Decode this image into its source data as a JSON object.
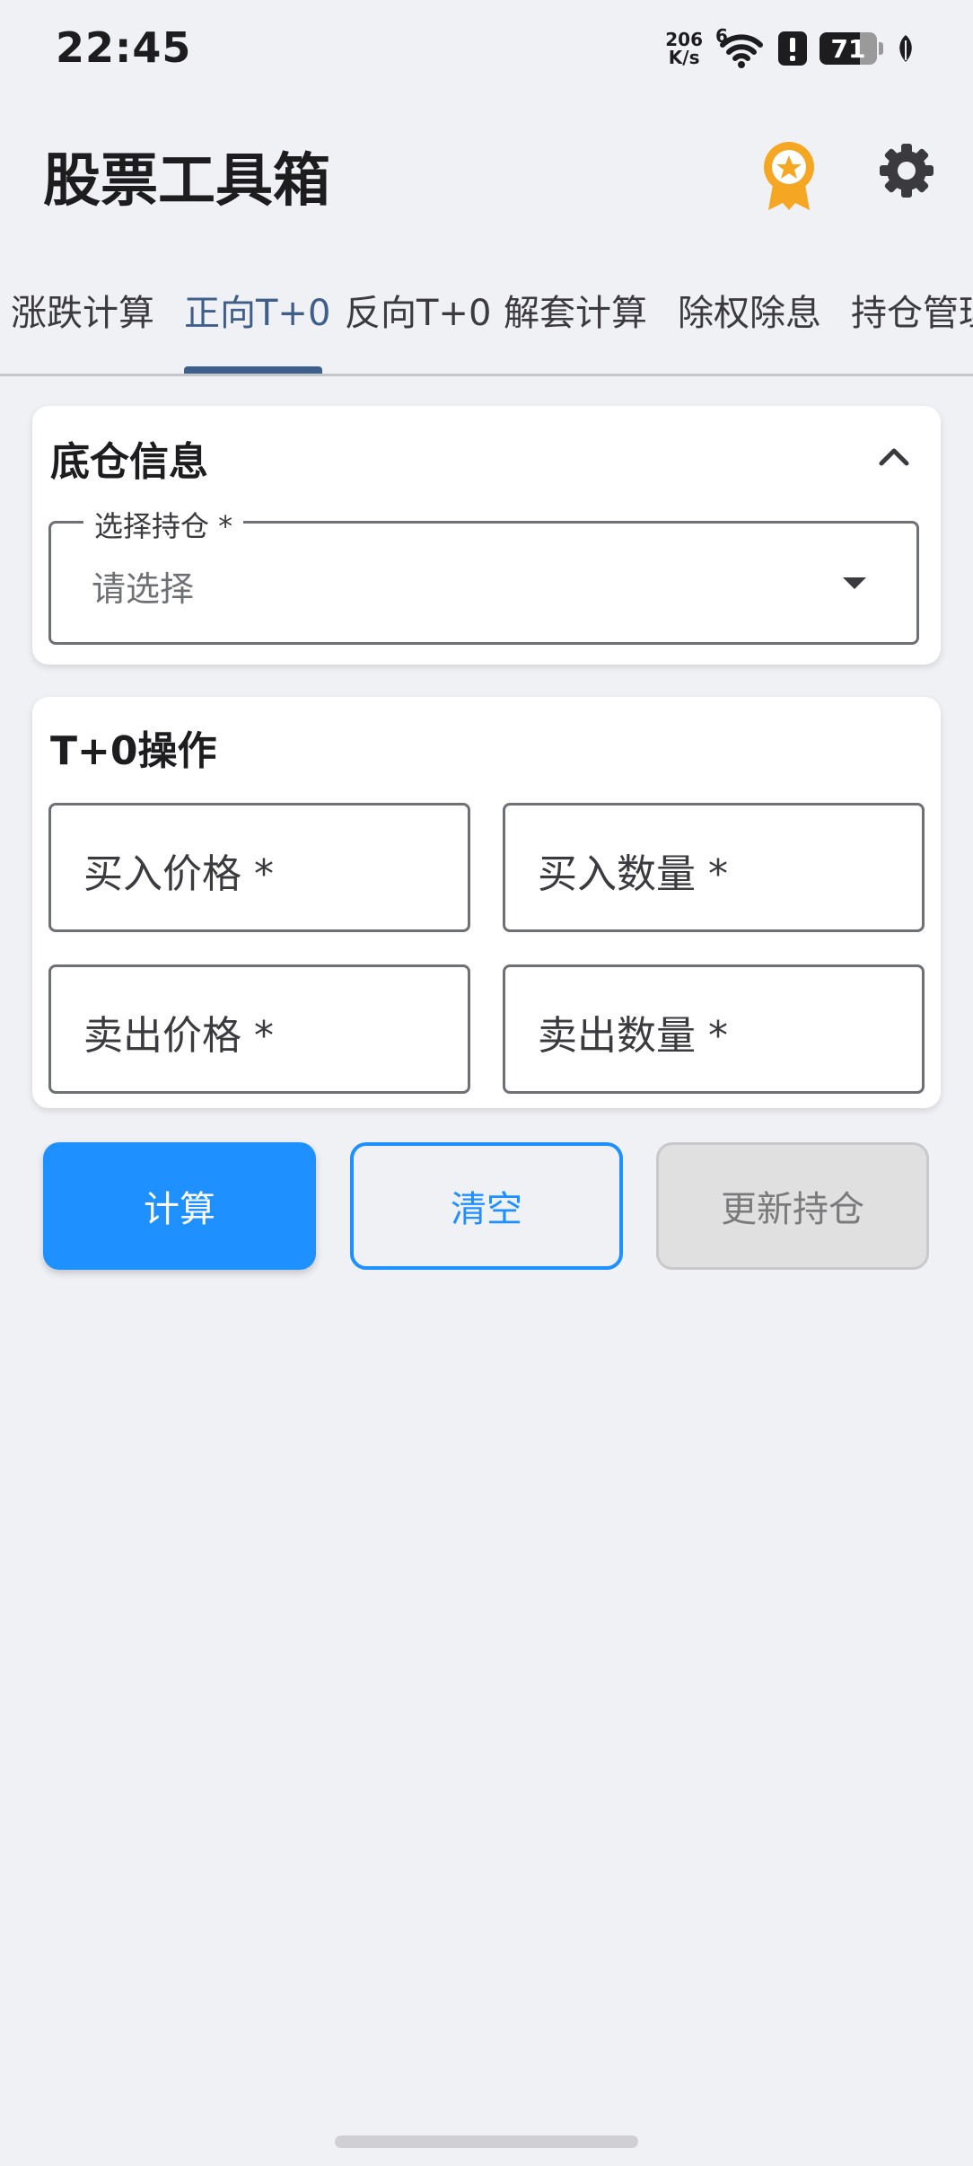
{
  "status_bar": {
    "time": "22:45",
    "net_speed_value": "206",
    "net_speed_unit": "K/s",
    "signal_label": "6",
    "battery_level": "71",
    "battery_percent": 71
  },
  "app_bar": {
    "title": "股票工具箱"
  },
  "tabs": [
    {
      "label": "涨跌计算",
      "active": false
    },
    {
      "label": "正向T+0",
      "active": true
    },
    {
      "label": "反向T+0",
      "active": false
    },
    {
      "label": "解套计算",
      "active": false
    },
    {
      "label": "除权除息",
      "active": false
    },
    {
      "label": "持仓管理",
      "active": false
    }
  ],
  "position_card": {
    "title": "底仓信息",
    "select_label": "选择持仓 *",
    "select_placeholder": "请选择"
  },
  "t0_card": {
    "title": "T+0操作",
    "buy_price_label": "买入价格 *",
    "buy_qty_label": "买入数量 *",
    "sell_price_label": "卖出价格 *",
    "sell_qty_label": "卖出数量 *"
  },
  "actions": {
    "calculate": "计算",
    "clear": "清空",
    "update_position": "更新持仓"
  },
  "colors": {
    "accent": "#1e90ff",
    "tab_active": "#3f5f8a",
    "award": "#f5a623",
    "background": "#f0f1f5"
  },
  "icons": {
    "award": "award-badge-icon",
    "settings": "gear-icon",
    "collapse": "chevron-up-icon",
    "dropdown": "caret-down-icon"
  }
}
